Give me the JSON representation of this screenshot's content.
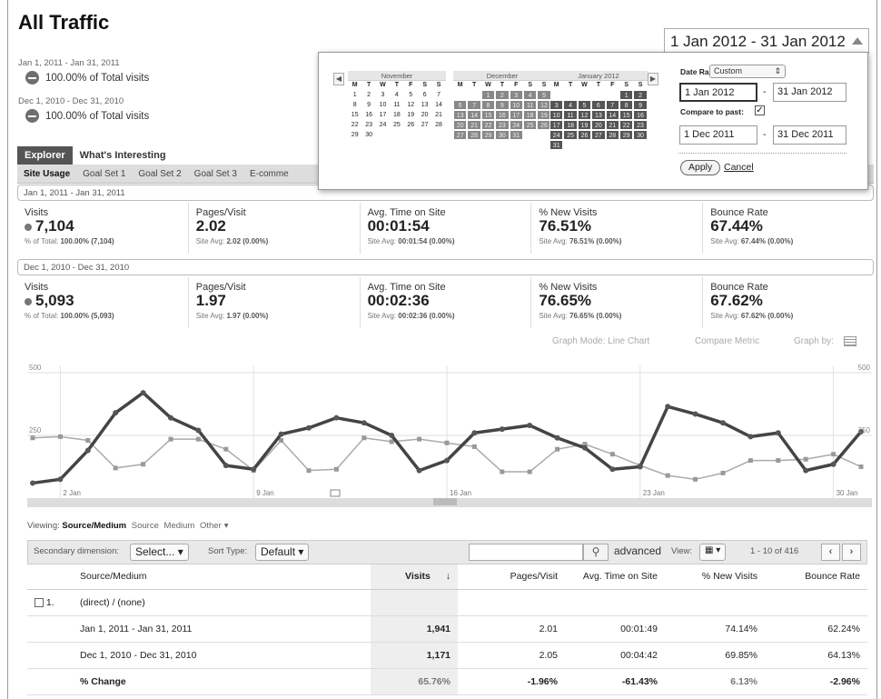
{
  "page": {
    "title": "All Traffic"
  },
  "legend": [
    {
      "range": "Jan 1, 2011 - Jan 31, 2011",
      "pct": "100.00% of Total visits"
    },
    {
      "range": "Dec 1, 2010 - Dec 31, 2010",
      "pct": "100.00% of Total visits"
    }
  ],
  "date_button": {
    "label": "1 Jan 2012 - 31 Jan 2012"
  },
  "datepicker": {
    "months": [
      {
        "name": "November",
        "weeks": [
          [
            "1",
            "2",
            "3",
            "4",
            "5",
            "6",
            "7"
          ],
          [
            "8",
            "9",
            "10",
            "11",
            "12",
            "13",
            "14"
          ],
          [
            "15",
            "16",
            "17",
            "18",
            "19",
            "20",
            "21"
          ],
          [
            "22",
            "23",
            "24",
            "25",
            "26",
            "27",
            "28"
          ],
          [
            "29",
            "30",
            "",
            "",
            "",
            "",
            ""
          ]
        ]
      },
      {
        "name": "December",
        "weeks": [
          [
            "",
            "",
            "1",
            "2",
            "3",
            "4",
            "5"
          ],
          [
            "6",
            "7",
            "8",
            "9",
            "10",
            "11",
            "12"
          ],
          [
            "13",
            "14",
            "15",
            "16",
            "17",
            "18",
            "19"
          ],
          [
            "20",
            "21",
            "22",
            "23",
            "24",
            "25",
            "26"
          ],
          [
            "27",
            "28",
            "29",
            "30",
            "31",
            "",
            ""
          ]
        ]
      },
      {
        "name": "January 2012",
        "weeks": [
          [
            "",
            "",
            "",
            "",
            "",
            "1",
            "2"
          ],
          [
            "3",
            "4",
            "5",
            "6",
            "7",
            "8",
            "9"
          ],
          [
            "10",
            "11",
            "12",
            "13",
            "14",
            "15",
            "16"
          ],
          [
            "17",
            "18",
            "19",
            "20",
            "21",
            "22",
            "23"
          ],
          [
            "24",
            "25",
            "26",
            "27",
            "28",
            "29",
            "30"
          ],
          [
            "31",
            "",
            "",
            "",
            "",
            "",
            ""
          ]
        ]
      }
    ],
    "dow": [
      "M",
      "T",
      "W",
      "T",
      "F",
      "S",
      "S"
    ],
    "date_range_label": "Date Range:",
    "date_range_value": "Custom",
    "start": "1 Jan 2012",
    "end": "31 Jan 2012",
    "compare_label": "Compare to past:",
    "compare_start": "1 Dec 2011",
    "compare_end": "31 Dec 2011",
    "apply": "Apply",
    "cancel": "Cancel",
    "dash": "-"
  },
  "tabs": {
    "explorer": "Explorer",
    "whats_interesting": "What's Interesting"
  },
  "subnav": [
    "Site Usage",
    "Goal Set 1",
    "Goal Set 2",
    "Goal Set 3",
    "E-comme"
  ],
  "periods": [
    {
      "range": "Jan 1, 2011 - Jan 31, 2011",
      "metrics": [
        {
          "label": "Visits",
          "value": "7,104",
          "sub_prefix": "% of Total:",
          "sub_value": "100.00% (7,104)"
        },
        {
          "label": "Pages/Visit",
          "value": "2.02",
          "sub_prefix": "Site Avg:",
          "sub_value": "2.02 (0.00%)"
        },
        {
          "label": "Avg. Time on Site",
          "value": "00:01:54",
          "sub_prefix": "Site Avg:",
          "sub_value": "00:01:54 (0.00%)"
        },
        {
          "label": "% New Visits",
          "value": "76.51%",
          "sub_prefix": "Site Avg:",
          "sub_value": "76.51% (0.00%)"
        },
        {
          "label": "Bounce Rate",
          "value": "67.44%",
          "sub_prefix": "Site Avg:",
          "sub_value": "67.44% (0.00%)"
        }
      ]
    },
    {
      "range": "Dec 1, 2010 - Dec 31, 2010",
      "metrics": [
        {
          "label": "Visits",
          "value": "5,093",
          "sub_prefix": "% of Total:",
          "sub_value": "100.00% (5,093)"
        },
        {
          "label": "Pages/Visit",
          "value": "1.97",
          "sub_prefix": "Site Avg:",
          "sub_value": "1.97 (0.00%)"
        },
        {
          "label": "Avg. Time on Site",
          "value": "00:02:36",
          "sub_prefix": "Site Avg:",
          "sub_value": "00:02:36 (0.00%)"
        },
        {
          "label": "% New Visits",
          "value": "76.65%",
          "sub_prefix": "Site Avg:",
          "sub_value": "76.65% (0.00%)"
        },
        {
          "label": "Bounce Rate",
          "value": "67.62%",
          "sub_prefix": "Site Avg:",
          "sub_value": "67.62% (0.00%)"
        }
      ]
    }
  ],
  "graph_controls": {
    "mode": "Graph Mode:",
    "mode_value": "Line Chart",
    "compare": "Compare Metric",
    "graph_by": "Graph by:"
  },
  "chart_data": {
    "type": "line",
    "x_tick_labels": [
      "2 Jan",
      "9 Jan",
      "16 Jan",
      "23 Jan",
      "30 Jan"
    ],
    "y_tick_labels": [
      "500",
      "250"
    ],
    "ylim": [
      0,
      500
    ],
    "series": [
      {
        "values": [
          60,
          75,
          190,
          340,
          420,
          320,
          270,
          130,
          115,
          255,
          280,
          320,
          300,
          250,
          110,
          150,
          260,
          275,
          290,
          240,
          200,
          115,
          125,
          365,
          335,
          300,
          245,
          260,
          110,
          135,
          265
        ]
      },
      {
        "values": [
          240,
          245,
          230,
          120,
          135,
          235,
          235,
          195,
          110,
          230,
          110,
          115,
          240,
          225,
          235,
          220,
          205,
          105,
          105,
          195,
          215,
          175,
          130,
          90,
          75,
          100,
          150,
          150,
          155,
          175,
          125
        ]
      }
    ],
    "grid": true
  },
  "viewing": {
    "label": "Viewing:",
    "selected": "Source/Medium",
    "options": [
      "Source",
      "Medium",
      "Other"
    ]
  },
  "toolbar": {
    "secondary_dimension": "Secondary dimension:",
    "select": "Select...",
    "sort_type": "Sort Type:",
    "sort_value": "Default",
    "advanced": "advanced",
    "view": "View:",
    "pager": "1 - 10 of 416"
  },
  "table": {
    "headers": [
      "Source/Medium",
      "Visits",
      "Pages/Visit",
      "Avg. Time on Site",
      "% New Visits",
      "Bounce Rate"
    ],
    "group": {
      "index": "1.",
      "name": "(direct) / (none)"
    },
    "rows": [
      {
        "name": "Jan 1, 2011 - Jan 31, 2011",
        "visits": "1,941",
        "ppv": "2.01",
        "time": "00:01:49",
        "new": "74.14%",
        "bounce": "62.24%"
      },
      {
        "name": "Dec 1, 2010 - Dec 31, 2010",
        "visits": "1,171",
        "ppv": "2.05",
        "time": "00:04:42",
        "new": "69.85%",
        "bounce": "64.13%"
      },
      {
        "name": "% Change",
        "visits": "65.76%",
        "ppv": "-1.96%",
        "time": "-61.43%",
        "new": "6.13%",
        "bounce": "-2.96%"
      }
    ]
  }
}
